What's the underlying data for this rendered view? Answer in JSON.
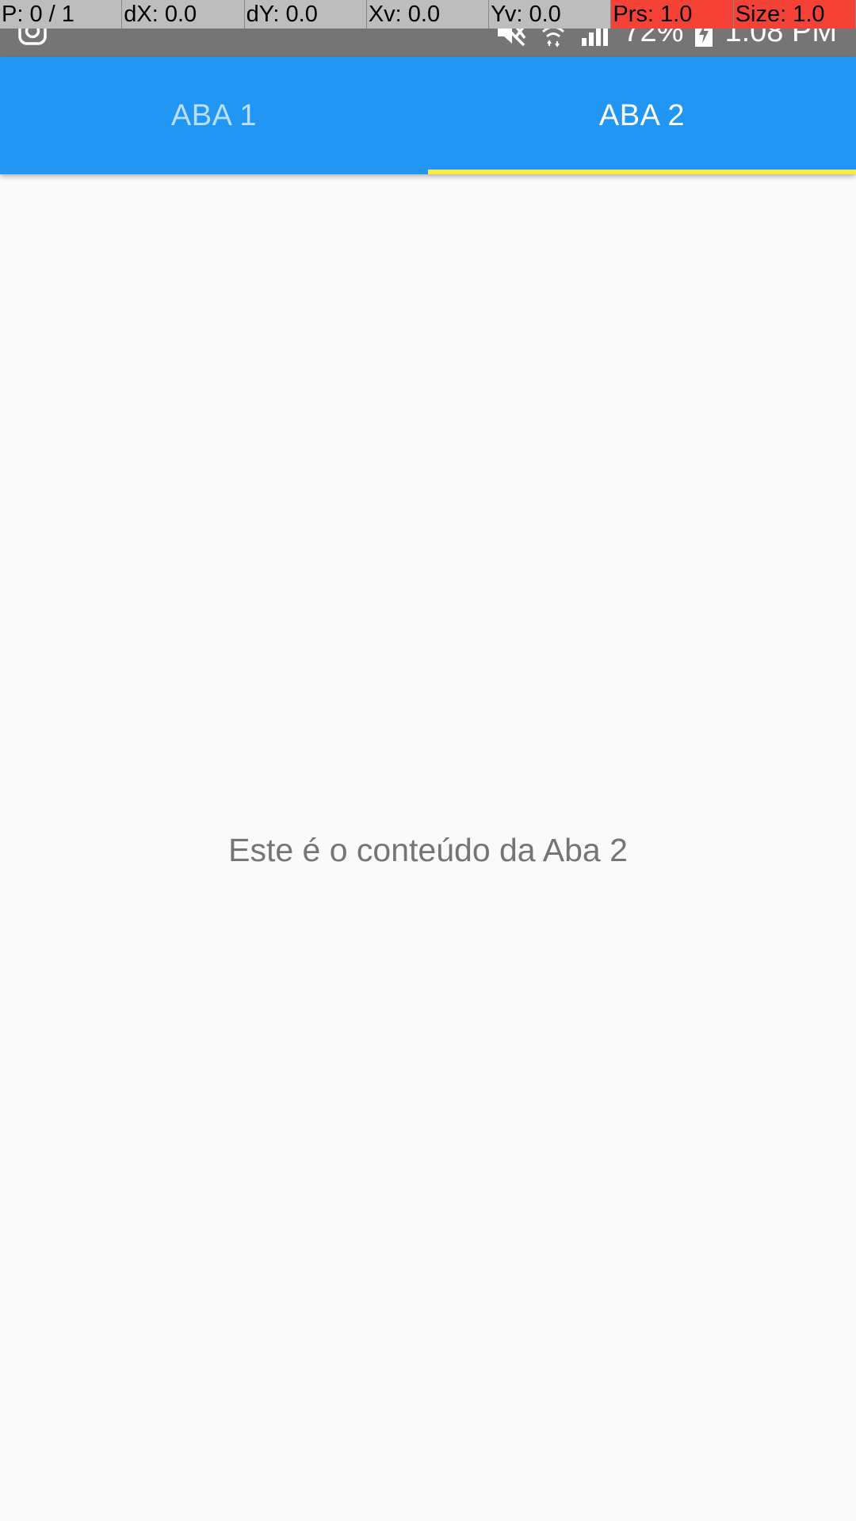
{
  "colors": {
    "status_bar": "#757575",
    "primary": "#2196f3",
    "indicator": "#ffeb3b",
    "tab_selected_text": "#ffffff",
    "tab_unselected_text": "#bbdefb",
    "content_text": "#757575",
    "background": "#fafafa",
    "debug_gray": "#bdbdbd",
    "debug_red": "#f44336"
  },
  "status_bar": {
    "left_icon": "instagram-icon",
    "icons": [
      "mute-icon",
      "wifi-icon",
      "signal-icon"
    ],
    "battery_percent": "72%",
    "battery_icon": "battery-charging-icon",
    "time": "1:08 PM"
  },
  "debug_overlay": {
    "cells": [
      {
        "text": "P: 0 / 1",
        "color": "#bdbdbd"
      },
      {
        "text": "dX: 0.0",
        "color": "#bdbdbd"
      },
      {
        "text": "dY: 0.0",
        "color": "#bdbdbd"
      },
      {
        "text": "Xv: 0.0",
        "color": "#bdbdbd"
      },
      {
        "text": "Yv: 0.0",
        "color": "#bdbdbd"
      },
      {
        "text": "Prs: 1.0",
        "color": "#f44336"
      },
      {
        "text": "Size: 1.0",
        "color": "#f44336"
      }
    ]
  },
  "tabs": {
    "items": [
      {
        "label": "ABA 1",
        "selected": false
      },
      {
        "label": "ABA 2",
        "selected": true
      }
    ],
    "selected_index": 1
  },
  "content": {
    "text": "Este é o conteúdo da Aba 2"
  }
}
